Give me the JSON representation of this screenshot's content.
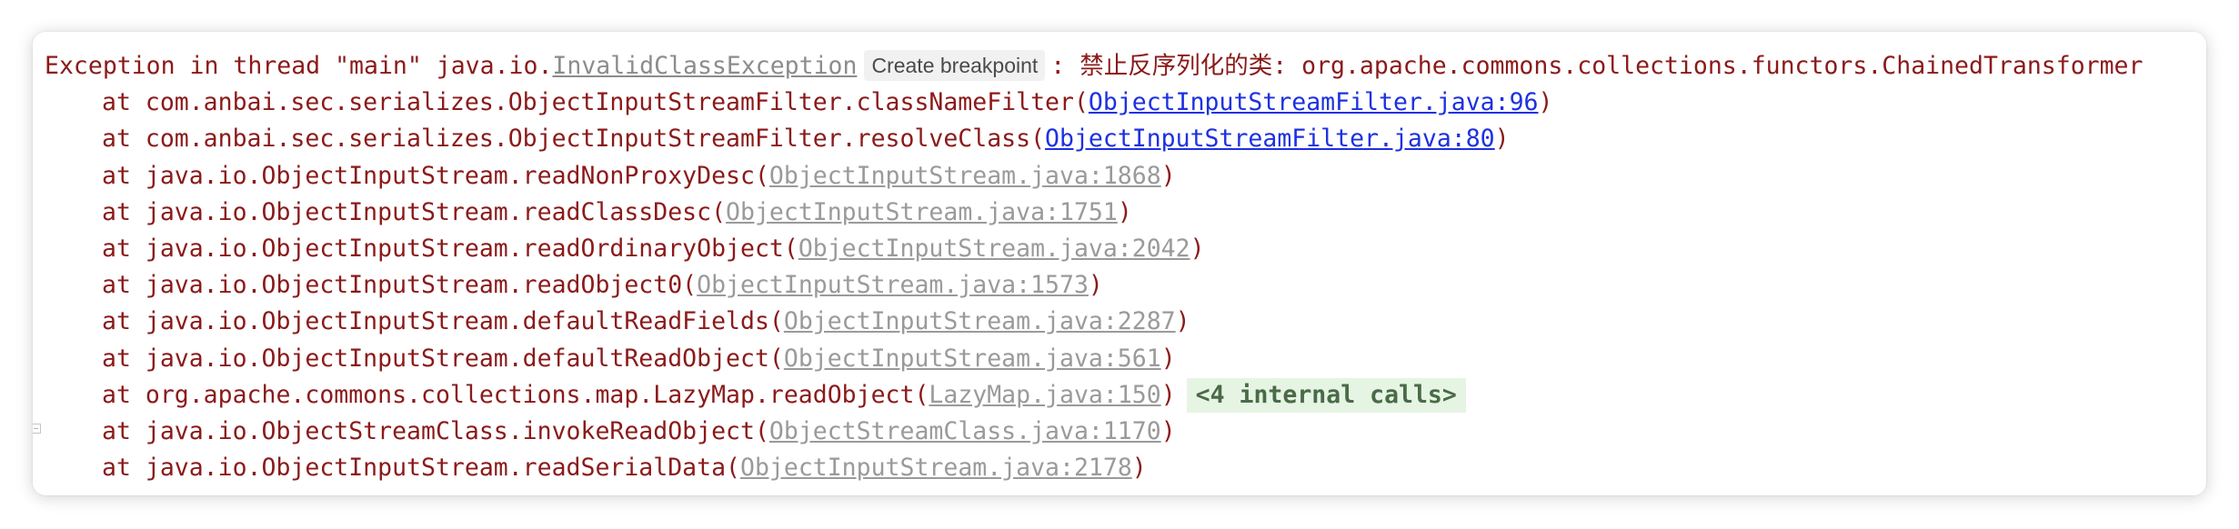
{
  "console": {
    "exception_prefix": "Exception in thread \"main\" java.io.",
    "exception_class": "InvalidClassException",
    "breakpoint_label": "Create breakpoint",
    "exception_message": ": 禁止反序列化的类: org.apache.commons.collections.functors.ChainedTransformer",
    "frames": [
      {
        "method": "at com.anbai.sec.serializes.ObjectInputStreamFilter.classNameFilter(",
        "source": "ObjectInputStreamFilter.java:96",
        "close": ")"
      },
      {
        "method": "at com.anbai.sec.serializes.ObjectInputStreamFilter.resolveClass(",
        "source": "ObjectInputStreamFilter.java:80",
        "close": ")"
      },
      {
        "method": "at java.io.ObjectInputStream.readNonProxyDesc(",
        "source": "ObjectInputStream.java:1868",
        "close": ")"
      },
      {
        "method": "at java.io.ObjectInputStream.readClassDesc(",
        "source": "ObjectInputStream.java:1751",
        "close": ")"
      },
      {
        "method": "at java.io.ObjectInputStream.readOrdinaryObject(",
        "source": "ObjectInputStream.java:2042",
        "close": ")"
      },
      {
        "method": "at java.io.ObjectInputStream.readObject0(",
        "source": "ObjectInputStream.java:1573",
        "close": ")"
      },
      {
        "method": "at java.io.ObjectInputStream.defaultReadFields(",
        "source": "ObjectInputStream.java:2287",
        "close": ")"
      },
      {
        "method": "at java.io.ObjectInputStream.defaultReadObject(",
        "source": "ObjectInputStream.java:561",
        "close": ")"
      },
      {
        "method": "at org.apache.commons.collections.map.LazyMap.readObject(",
        "source": "LazyMap.java:150",
        "close": ")",
        "internal_calls": "<4 internal calls>"
      },
      {
        "method": "at java.io.ObjectStreamClass.invokeReadObject(",
        "source": "ObjectStreamClass.java:1170",
        "close": ")"
      },
      {
        "method": "at java.io.ObjectInputStream.readSerialData(",
        "source": "ObjectInputStream.java:2178",
        "close": ")"
      }
    ]
  },
  "colors": {
    "error_text": "#8b1a1a",
    "project_link": "#1d31e0",
    "library_link": "#9a9a9a",
    "internal_calls_bg": "#e6f5e3"
  },
  "icons": {
    "fold_marker": "fold-collapse-icon"
  }
}
